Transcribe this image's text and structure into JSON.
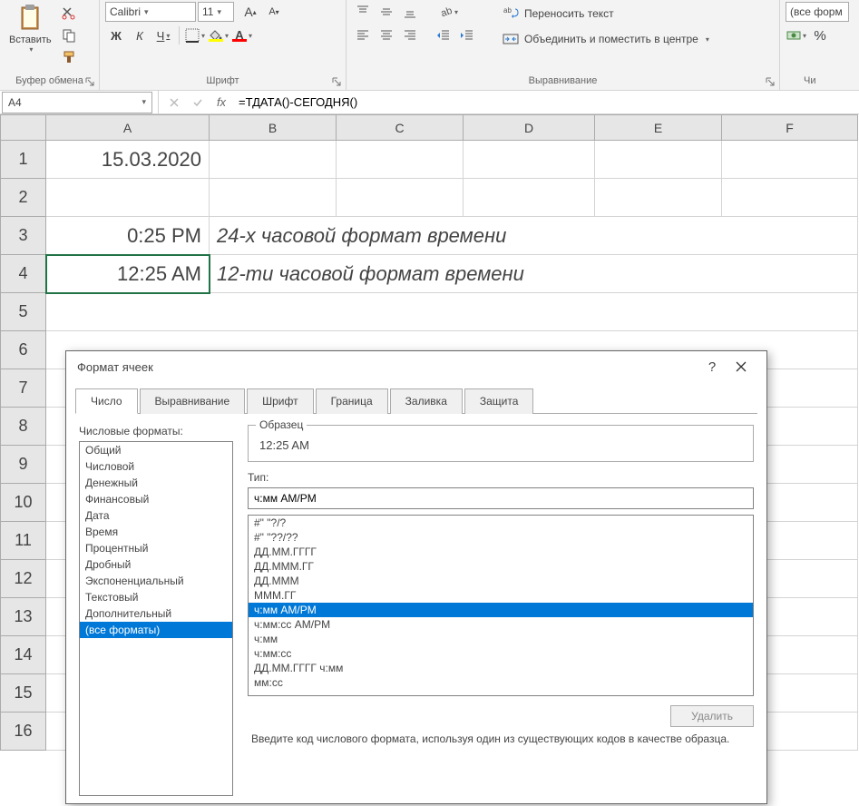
{
  "ribbon": {
    "clipboard": {
      "paste_label": "Вставить",
      "group_label": "Буфер обмена"
    },
    "font": {
      "name": "Calibri",
      "size": "11",
      "bold": "Ж",
      "italic": "К",
      "underline": "Ч",
      "group_label": "Шрифт"
    },
    "alignment": {
      "wrap_label": "Переносить текст",
      "merge_label": "Объединить и поместить в центре",
      "group_label": "Выравнивание"
    },
    "number": {
      "combo_value": "(все форм",
      "group_label": "Чи"
    }
  },
  "name_box": {
    "value": "A4"
  },
  "formula": {
    "value": "=ТДАТА()-СЕГОДНЯ()"
  },
  "columns": [
    "A",
    "B",
    "C",
    "D",
    "E",
    "F"
  ],
  "rows": [
    "1",
    "2",
    "3",
    "4",
    "5",
    "6",
    "7",
    "8",
    "9",
    "10",
    "11",
    "12",
    "13",
    "14",
    "15",
    "16"
  ],
  "cells": {
    "A1": "15.03.2020",
    "A3": "0:25 PM",
    "A4": "12:25 AM",
    "B3": "24-х часовой формат времени",
    "B4": "12-ти часовой формат времени"
  },
  "dialog": {
    "title": "Формат ячеек",
    "tabs": [
      "Число",
      "Выравнивание",
      "Шрифт",
      "Граница",
      "Заливка",
      "Защита"
    ],
    "active_tab": 0,
    "categories_label": "Числовые форматы:",
    "categories": [
      "Общий",
      "Числовой",
      "Денежный",
      "Финансовый",
      "Дата",
      "Время",
      "Процентный",
      "Дробный",
      "Экспоненциальный",
      "Текстовый",
      "Дополнительный",
      "(все форматы)"
    ],
    "selected_category": 11,
    "sample_label": "Образец",
    "sample_value": "12:25 AM",
    "type_label": "Тип:",
    "type_value": "ч:мм AM/PM",
    "type_list": [
      "#\" \"?/?",
      "#\" \"??/??",
      "ДД.ММ.ГГГГ",
      "ДД.МММ.ГГ",
      "ДД.МММ",
      "МММ.ГГ",
      "ч:мм AM/PM",
      "ч:мм:сс AM/PM",
      "ч:мм",
      "ч:мм:сс",
      "ДД.ММ.ГГГГ ч:мм",
      "мм:сс"
    ],
    "selected_type": 6,
    "delete_label": "Удалить",
    "hint": "Введите код числового формата, используя один из существующих кодов в качестве образца."
  }
}
